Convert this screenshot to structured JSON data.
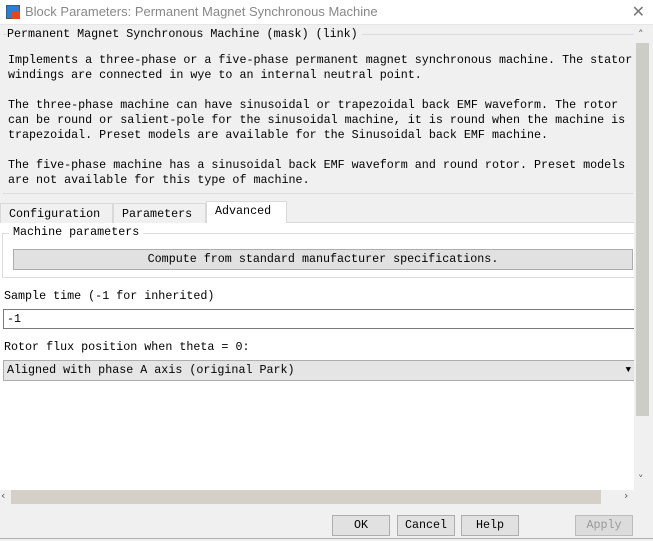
{
  "window": {
    "title": "Block Parameters: Permanent Magnet Synchronous Machine",
    "close_icon": "close-icon"
  },
  "description": {
    "legend": "Permanent Magnet Synchronous Machine (mask) (link)",
    "paragraphs": [
      "Implements a three-phase or a five-phase permanent magnet synchronous machine. The stator\nwindings are connected in wye to an internal neutral point.",
      "The three-phase machine can have sinusoidal or trapezoidal back EMF waveform. The rotor\ncan be round or salient-pole for the sinusoidal machine, it is round when the machine is\ntrapezoidal. Preset models are available for the Sinusoidal back EMF machine.",
      "The five-phase machine has a sinusoidal back EMF waveform and round rotor. Preset models\nare not available for this type of machine."
    ]
  },
  "tabs": [
    {
      "label": "Configuration"
    },
    {
      "label": "Parameters"
    },
    {
      "label": "Advanced",
      "active": true
    }
  ],
  "advanced": {
    "machine_parameters_legend": "Machine parameters",
    "compute_button": "Compute from standard manufacturer specifications.",
    "sample_time_label": "Sample time (-1 for inherited)",
    "sample_time_value": "-1",
    "rotor_flux_label": "Rotor flux position when theta = 0:",
    "rotor_flux_value": "Aligned with phase A axis (original Park)"
  },
  "buttons": {
    "ok": "OK",
    "cancel": "Cancel",
    "help": "Help",
    "apply": "Apply"
  }
}
